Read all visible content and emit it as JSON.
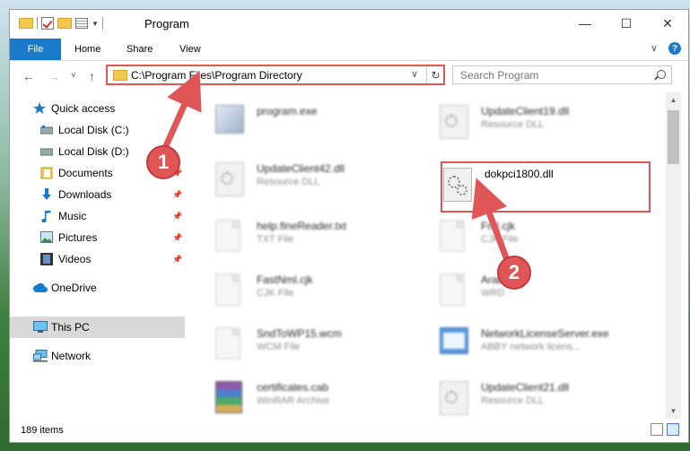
{
  "window": {
    "title": "Program",
    "caption": {
      "minimize": "—",
      "maximize": "☐",
      "close": "✕"
    }
  },
  "ribbon": {
    "tabs": [
      "File",
      "Home",
      "Share",
      "View"
    ],
    "help": "?"
  },
  "nav": {
    "back": "←",
    "forward": "→",
    "recent": "˅",
    "up": "↑",
    "address": "C:\\Program Files\\Program Directory",
    "refresh": "↻",
    "search_placeholder": "Search Program"
  },
  "sidebar": {
    "items": [
      {
        "label": "Quick access",
        "icon": "star-icon",
        "pinned": false
      },
      {
        "label": "Local Disk (C:)",
        "icon": "drive-icon",
        "pinned": false
      },
      {
        "label": "Local Disk (D:)",
        "icon": "drive-icon",
        "pinned": false
      },
      {
        "label": "Documents",
        "icon": "documents-icon",
        "pinned": true
      },
      {
        "label": "Downloads",
        "icon": "download-icon",
        "pinned": true
      },
      {
        "label": "Music",
        "icon": "music-icon",
        "pinned": true
      },
      {
        "label": "Pictures",
        "icon": "pictures-icon",
        "pinned": true
      },
      {
        "label": "Videos",
        "icon": "videos-icon",
        "pinned": true
      },
      {
        "label": "OneDrive",
        "icon": "cloud-icon",
        "pinned": false
      },
      {
        "label": "This PC",
        "icon": "computer-icon",
        "pinned": false,
        "selected": true
      },
      {
        "label": "Network",
        "icon": "network-icon",
        "pinned": false
      }
    ]
  },
  "files": [
    {
      "name": "program.exe",
      "type": "",
      "icon": "program-icon"
    },
    {
      "name": "UpdateClient19.dll",
      "type": "Resource DLL",
      "icon": "dll-icon"
    },
    {
      "name": "UpdateClient42.dll",
      "type": "Resource DLL",
      "icon": "dll-icon"
    },
    {
      "name": "dokpci1800.dll",
      "type": "",
      "icon": "gear-file-icon",
      "highlighted": true
    },
    {
      "name": "help.fineReader.txt",
      "type": "TXT File",
      "icon": "text-file-icon"
    },
    {
      "name": "Fml.cjk",
      "type": "CJK File",
      "icon": "file-icon"
    },
    {
      "name": "FastNml.cjk",
      "type": "CJK File",
      "icon": "file-icon"
    },
    {
      "name": "Arabic",
      "type": "WRD",
      "icon": "file-icon"
    },
    {
      "name": "SndToWP15.wcm",
      "type": "WCM File",
      "icon": "file-icon"
    },
    {
      "name": "NetworkLicenseServer.exe",
      "type": "ABBY network licens...",
      "icon": "exe-icon"
    },
    {
      "name": "certificates.cab",
      "type": "WinRAR Archive",
      "icon": "archive-icon"
    },
    {
      "name": "UpdateClient21.dll",
      "type": "Resource DLL",
      "icon": "dll-icon"
    }
  ],
  "status": {
    "items_count": "189 items"
  },
  "callouts": [
    "1",
    "2"
  ],
  "colors": {
    "accent": "#1979ca",
    "annotation": "#e05555"
  }
}
